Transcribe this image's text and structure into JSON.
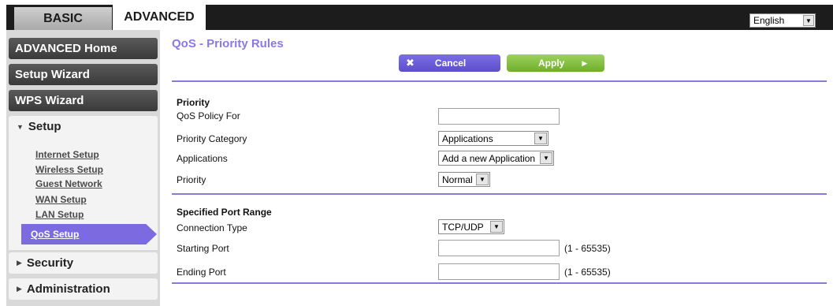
{
  "tabs": {
    "basic": "BASIC",
    "advanced": "ADVANCED"
  },
  "language": {
    "selected": "English"
  },
  "sidebar": {
    "advanced_home": "ADVANCED Home",
    "setup_wizard": "Setup Wizard",
    "wps_wizard": "WPS Wizard",
    "setup": {
      "label": "Setup",
      "arrow": "▼"
    },
    "setup_items": [
      "Internet Setup",
      "Wireless Setup",
      "Guest Network",
      "WAN Setup",
      "LAN Setup",
      "QoS Setup"
    ],
    "security": {
      "label": "Security",
      "arrow": "▶"
    },
    "administration": {
      "label": "Administration",
      "arrow": "▶"
    }
  },
  "main": {
    "title": "QoS - Priority Rules",
    "cancel_label": "Cancel",
    "apply_label": "Apply",
    "priority_section": "Priority",
    "qos_policy_for": {
      "label": "QoS Policy For",
      "value": ""
    },
    "priority_category": {
      "label": "Priority Category",
      "selected": "Applications"
    },
    "applications": {
      "label": "Applications",
      "selected": "Add a new Application"
    },
    "priority": {
      "label": "Priority",
      "selected": "Normal"
    },
    "port_section": "Specified Port Range",
    "connection_type": {
      "label": "Connection Type",
      "selected": "TCP/UDP"
    },
    "starting_port": {
      "label": "Starting Port",
      "value": "",
      "range": "(1 - 65535)"
    },
    "ending_port": {
      "label": "Ending Port",
      "value": "",
      "range": "(1 - 65535)"
    }
  },
  "colors": {
    "accent": "#8a78e6",
    "apply": "#7ab83a",
    "sidebar_dark": "#444444"
  }
}
